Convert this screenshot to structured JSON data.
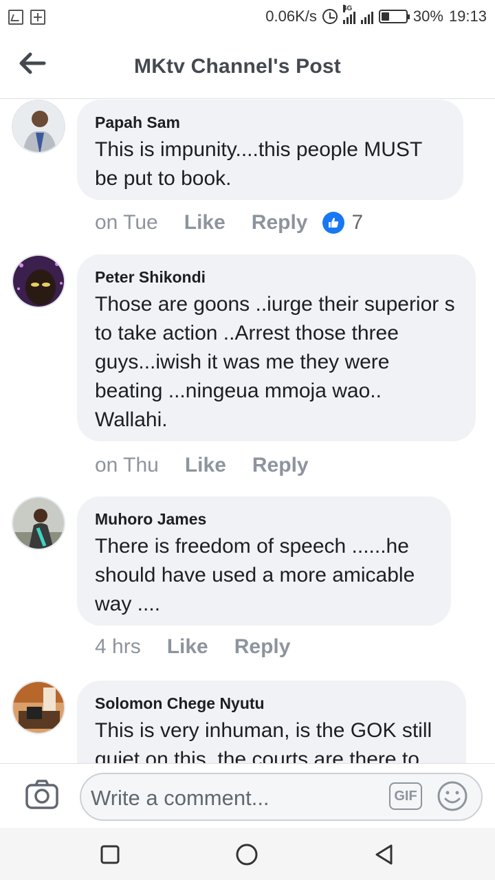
{
  "status_bar": {
    "net_speed": "0.06K/s",
    "network_type": "4G",
    "battery": "30%",
    "time": "19:13"
  },
  "header": {
    "title": "MKtv Channel's Post",
    "back_icon": "arrow-left-icon"
  },
  "comments": [
    {
      "author": "Papah Sam",
      "text": "This is impunity....this people MUST be put to book.",
      "time": "on Tue",
      "like_label": "Like",
      "reply_label": "Reply",
      "reaction_count": "7"
    },
    {
      "author": "Peter Shikondi",
      "text": "Those are goons ..iurge their superior s to take action ..Arrest those three guys...iwish it was me they were beating ...ningeua mmoja wao.. Wallahi.",
      "time": "on Thu",
      "like_label": "Like",
      "reply_label": "Reply"
    },
    {
      "author": "Muhoro James",
      "text": "There is freedom of speech ......he should have used a more amicable way ....",
      "time": "4 hrs",
      "like_label": "Like",
      "reply_label": "Reply"
    },
    {
      "author": "Solomon Chege Nyutu",
      "text": "This is very inhuman, is the GOK still quiet on this, the courts are there to"
    }
  ],
  "composer": {
    "placeholder": "Write a comment...",
    "gif_label": "GIF",
    "camera_icon": "camera-icon",
    "emoji_icon": "smiley-icon"
  },
  "colors": {
    "bubble": "#f0f2f5",
    "like_blue": "#1877f2",
    "meta_gray": "#8d949e"
  }
}
